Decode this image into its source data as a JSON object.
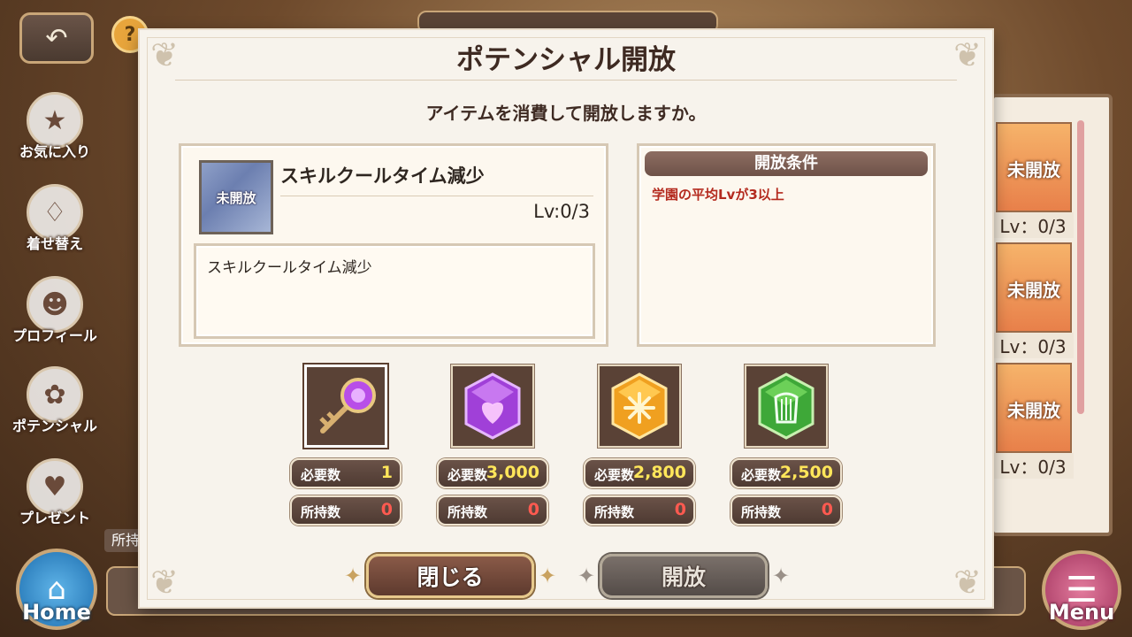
{
  "background": {
    "side_menu": [
      {
        "label": "お気に入り",
        "icon": "star-icon"
      },
      {
        "label": "着せ替え",
        "icon": "dress-icon"
      },
      {
        "label": "プロフィール",
        "icon": "profile-icon"
      },
      {
        "label": "ポテンシャル",
        "icon": "flower-icon"
      },
      {
        "label": "プレゼント",
        "icon": "heart-icon"
      }
    ],
    "home_label": "Home",
    "menu_label": "Menu",
    "owned_tag": "所持",
    "right_cards": [
      {
        "status": "未開放",
        "level": "Lv：0/3"
      },
      {
        "status": "未開放",
        "level": "Lv：0/3"
      },
      {
        "status": "未開放",
        "level": "Lv：0/3"
      }
    ]
  },
  "modal": {
    "title": "ポテンシャル開放",
    "question": "アイテムを消費して開放しますか。",
    "skill": {
      "icon_status": "未開放",
      "name": "スキルクールタイム減少",
      "level": "Lv:0/3",
      "description": "スキルクールタイム減少"
    },
    "conditions": {
      "header": "開放条件",
      "items": [
        "学園の平均Lvが3以上"
      ]
    },
    "items": [
      {
        "icon": "key-icon",
        "required_label": "必要数",
        "required": "1",
        "owned_label": "所持数",
        "owned": "0",
        "color": "#9a3fd0"
      },
      {
        "icon": "purple-heart-crystal-icon",
        "required_label": "必要数",
        "required": "3,000",
        "owned_label": "所持数",
        "owned": "0",
        "color": "#b04ae0"
      },
      {
        "icon": "orange-sun-crystal-icon",
        "required_label": "必要数",
        "required": "2,800",
        "owned_label": "所持数",
        "owned": "0",
        "color": "#f0a020"
      },
      {
        "icon": "green-harp-crystal-icon",
        "required_label": "必要数",
        "required": "2,500",
        "owned_label": "所持数",
        "owned": "0",
        "color": "#4ab040"
      }
    ],
    "buttons": {
      "close": "閉じる",
      "open": "開放"
    }
  }
}
